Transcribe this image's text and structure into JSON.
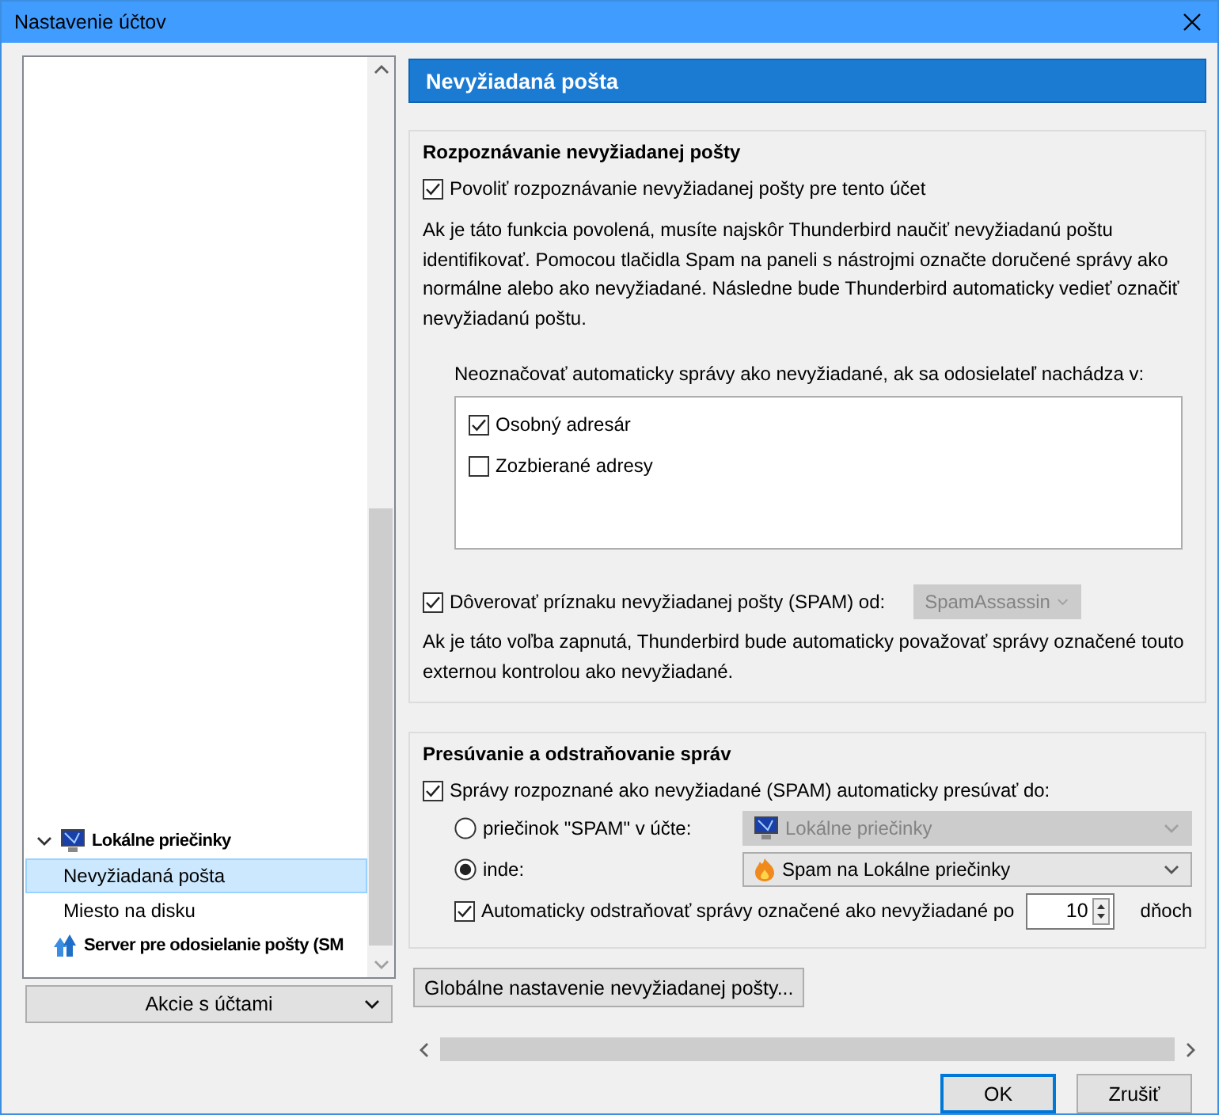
{
  "window": {
    "title": "Nastavenie účtov"
  },
  "tree": {
    "items": [
      {
        "label": "Lokálne priečinky",
        "kind": "folders",
        "expanded": true,
        "selected": false,
        "children": [
          {
            "label": "Nevyžiadaná pošta",
            "selected": true
          },
          {
            "label": "Miesto na disku",
            "selected": false
          }
        ]
      },
      {
        "label": "Server pre odosielanie pošty (SM",
        "kind": "server",
        "selected": false
      }
    ]
  },
  "account_actions": {
    "label": "Akcie s účtami"
  },
  "panel": {
    "title": "Nevyžiadaná pošta"
  },
  "detection": {
    "title": "Rozpoznávanie nevyžiadanej pošty",
    "enable": {
      "label": "Povoliť rozpoznávanie nevyžiadanej pošty pre tento účet",
      "checked": true
    },
    "description": "Ak je táto funkcia povolená, musíte najskôr Thunderbird naučiť nevyžiadanú poštu identifikovať. Pomocou tlačidla Spam na paneli s nástrojmi označte doručené správy ako normálne alebo ako nevyžiadané. Následne bude Thunderbird automaticky vedieť označiť nevyžiadanú poštu.",
    "whitelist_label": "Neoznačovať automaticky správy ako nevyžiadané, ak sa odosielateľ nachádza v:",
    "whitelist": [
      {
        "label": "Osobný adresár",
        "checked": true
      },
      {
        "label": "Zozbierané adresy",
        "checked": false
      }
    ],
    "trust": {
      "label": "Dôverovať príznaku nevyžiadanej pošty (SPAM) od:",
      "checked": true
    },
    "trust_select": {
      "value": "SpamAssassin",
      "disabled": true
    },
    "trust_description": "Ak je táto voľba zapnutá, Thunderbird bude automaticky považovať správy označené touto externou kontrolou ako nevyžiadané."
  },
  "moving": {
    "title": "Presúvanie a odstraňovanie správ",
    "move": {
      "label": "Správy rozpoznané ako nevyžiadané (SPAM) automaticky presúvať do:",
      "checked": true
    },
    "targets": [
      {
        "label": "priečinok \"SPAM\" v účte:",
        "selected": false,
        "value": "Lokálne priečinky",
        "kind": "folders",
        "disabled": true
      },
      {
        "label": "inde:",
        "selected": true,
        "value": "Spam na Lokálne priečinky",
        "kind": "junk",
        "disabled": false
      }
    ],
    "purge": {
      "label": "Automaticky odstraňovať správy označené ako nevyžiadané po",
      "checked": true
    },
    "days": "10",
    "days_unit": "dňoch"
  },
  "global_button": "Globálne nastavenie nevyžiadanej pošty...",
  "buttons": [
    {
      "label": "OK",
      "default": true
    },
    {
      "label": "Zrušiť",
      "default": false
    }
  ]
}
